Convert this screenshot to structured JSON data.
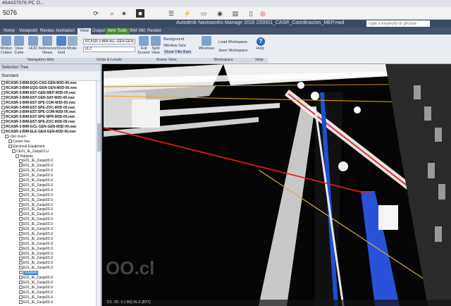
{
  "browser": {
    "tab_text": "464437076  PC O...",
    "url": "5076"
  },
  "app": {
    "title": "Autodesk Navisworks Manage 2016   220001_CASR_Coordinacion_MEP.nwd",
    "search_placeholder": "Type a keyword or phrase"
  },
  "tabs": [
    "Home",
    "Viewpoint",
    "Review",
    "Animation",
    "View",
    "Output",
    "Item Tools",
    "BIM 360",
    "Render"
  ],
  "ribbon": {
    "buttons": [
      "Motion Cubes",
      "View Cube",
      "HUD",
      "Reference Views",
      "Show Grid",
      "Mode",
      "Full Screen",
      "Split View",
      "Windows",
      "Help"
    ],
    "background_label": "Background",
    "window_size_label": "Window Size",
    "show_title_bars_label": "Show Title Bars",
    "load_workspace_label": "Load Workspace",
    "save_workspace_label": "Save Workspace",
    "grid_combo": "RCASR-3-BIM-ALL-GEN-GEN-...",
    "level_combo": "IS-2",
    "groups": [
      "Navigation Aids",
      "Grids & Levels",
      "Scene View",
      "Workspace",
      "Help"
    ]
  },
  "panel": {
    "title": "Selection Tree",
    "dropdown": "Standard",
    "rows": [
      {
        "text": "RCASR-3-BIM-EQG-CAS-GEN-M3D-00.nwc",
        "bold": true,
        "indent": 0
      },
      {
        "text": "RCASR-3-BIM-EQG-GEN-GEN-M3D-00.nwc",
        "bold": true,
        "indent": 0
      },
      {
        "text": "RCASR-3-BIM-EST-GEN-MEP-M3D-00.nwc",
        "bold": true,
        "indent": 0
      },
      {
        "text": "RCASR-3-BIM-EST-GEN-SAT-M3D-00.nwc",
        "bold": true,
        "indent": 0
      },
      {
        "text": "RCASR-3-BIM-EST-SPE-COR-M3D-00.nwc",
        "bold": true,
        "indent": 0
      },
      {
        "text": "RCASR-3-BIM-EST-SPE-ZOC-M3D-00.nwc",
        "bold": true,
        "indent": 0
      },
      {
        "text": "RCASR-3-BIM-EST-SPE-COM-M3D-00.nwc",
        "bold": true,
        "indent": 0
      },
      {
        "text": "RCASR-3-BIM-EST-SPE-NPR-M3D-00.nwc",
        "bold": true,
        "indent": 0
      },
      {
        "text": "RCASR-3-BIM-EST-SPE-ZOC-M3D-00.nwc",
        "bold": true,
        "indent": 0
      },
      {
        "text": "RCASR-3-BIM-GCL-GEN-GEN-M3D-00.nwc",
        "bold": true,
        "indent": 0
      },
      {
        "text": "RCASR-3-BIM-ELE-GEN-GEN-M3D-00.nwc",
        "bold": true,
        "indent": 0
      },
      {
        "text": "<Sin nivel>",
        "bold": false,
        "indent": 1
      },
      {
        "text": "Center line",
        "bold": false,
        "indent": 2
      },
      {
        "text": "Electrical Equipment",
        "bold": false,
        "indent": 2
      },
      {
        "text": "CE01_IE_Zanja03.U",
        "bold": false,
        "indent": 3
      },
      {
        "text": "Vidalsito",
        "bold": false,
        "indent": 4
      },
      {
        "text": "E01_IE_Zanja03.U",
        "bold": false,
        "indent": 5
      },
      {
        "text": "E01_IE_Zanja03.U",
        "bold": false,
        "indent": 5
      },
      {
        "text": "E01_IE_Zanja03.U",
        "bold": false,
        "indent": 5
      },
      {
        "text": "E01_IE_Zanja03.U",
        "bold": false,
        "indent": 5
      },
      {
        "text": "E01_IE_Zanja03.U",
        "bold": false,
        "indent": 5
      },
      {
        "text": "E01_IE_Zanja03.U",
        "bold": false,
        "indent": 5
      },
      {
        "text": "E01_IE_Zanja03.U",
        "bold": false,
        "indent": 5
      },
      {
        "text": "E01_IE_Zanja03.U",
        "bold": false,
        "indent": 5
      },
      {
        "text": "E01_IE_Zanja03.U",
        "bold": false,
        "indent": 5
      },
      {
        "text": "E01_IE_Zanja03.U",
        "bold": false,
        "indent": 5
      },
      {
        "text": "E01_IE_Zanja03.U",
        "bold": false,
        "indent": 5
      },
      {
        "text": "E01_IE_Zanja03.U",
        "bold": false,
        "indent": 5
      },
      {
        "text": "E01_IE_Zanja03.U",
        "bold": false,
        "indent": 5
      },
      {
        "text": "E01_IE_Zanja03.U",
        "bold": false,
        "indent": 5
      },
      {
        "text": "E01_IE_Zanja03.U",
        "bold": false,
        "indent": 5
      },
      {
        "text": "E01_IE_Zanja03.U",
        "bold": false,
        "indent": 5
      },
      {
        "text": "E01_IE_Zanja03.U",
        "bold": false,
        "indent": 5
      },
      {
        "text": "E01_IE_Zanja03.U",
        "bold": false,
        "indent": 5
      },
      {
        "text": "E01_IE_Zanja03.U",
        "bold": false,
        "indent": 5
      },
      {
        "text": "E01_IE_Zanja03.U",
        "bold": false,
        "indent": 5
      },
      {
        "text": "E01_IE_Zanja03.U",
        "bold": false,
        "indent": 5
      },
      {
        "text": "E01_IE_Zanja03.U",
        "bold": false,
        "indent": 5
      },
      {
        "text": "E01_IE_Zanja03.U",
        "bold": false,
        "indent": 5
      },
      {
        "text": "Vidalsito",
        "bold": false,
        "indent": 5,
        "selected": true
      },
      {
        "text": "E01_IE_Zanja03.U",
        "bold": false,
        "indent": 5
      },
      {
        "text": "E01_IE_Zanja03.U",
        "bold": false,
        "indent": 5
      },
      {
        "text": "E01_IE_Zanja03.U",
        "bold": false,
        "indent": 5
      },
      {
        "text": "E01_IE_Zanja03.U",
        "bold": false,
        "indent": 5
      },
      {
        "text": "E01_IE_Zanja03.U",
        "bold": false,
        "indent": 5
      },
      {
        "text": "E01_IE_Zanja03.U",
        "bold": false,
        "indent": 5
      }
    ]
  },
  "status": {
    "text": "7/1 -25 -1 (-90)    IS-2 (877)"
  },
  "watermark": "OO.cl"
}
